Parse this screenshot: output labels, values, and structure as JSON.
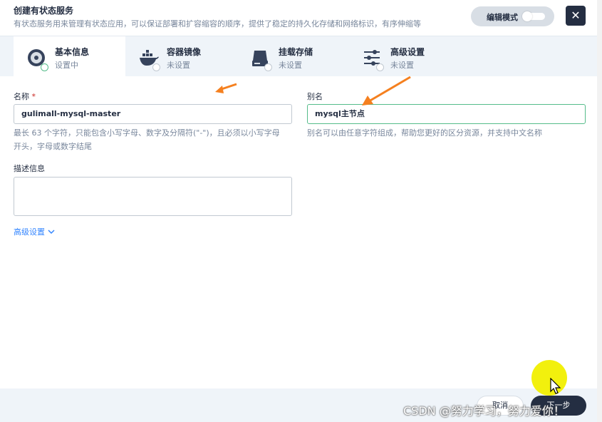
{
  "header": {
    "title": "创建有状态服务",
    "subtitle": "有状态服务用来管理有状态应用，可以保证部署和扩容缩容的顺序，提供了稳定的持久化存储和网络标识，有序伸缩等",
    "edit_mode_label": "编辑模式",
    "close_glyph": "✕"
  },
  "tabs": [
    {
      "title": "基本信息",
      "status": "设置中",
      "icon": "disc-icon",
      "active": true
    },
    {
      "title": "容器镜像",
      "status": "未设置",
      "icon": "docker-icon",
      "active": false
    },
    {
      "title": "挂载存储",
      "status": "未设置",
      "icon": "storage-icon",
      "active": false
    },
    {
      "title": "高级设置",
      "status": "未设置",
      "icon": "sliders-icon",
      "active": false
    }
  ],
  "form": {
    "name_label": "名称",
    "name_required": "*",
    "name_value": "gulimall-mysql-master",
    "name_help_line1": "最长 63 个字符，只能包含小写字母、数字及分隔符(\"-\")，且必须以小写字母",
    "name_help_line2": "开头，字母或数字结尾",
    "alias_label": "别名",
    "alias_value": "mysql主节点",
    "alias_help": "别名可以由任意字符组成，帮助您更好的区分资源，并支持中文名称",
    "description_label": "描述信息",
    "description_value": "",
    "advanced_link": "高级设置"
  },
  "footer": {
    "cancel_label": "取消",
    "next_label": "下一步"
  },
  "watermark": "CSDN @努力学习，努力爱你！",
  "colors": {
    "accent_green": "#55bc8a",
    "dark": "#242e42",
    "annotation_arrow": "#f5801f",
    "cursor_highlight": "#f1ef00"
  }
}
